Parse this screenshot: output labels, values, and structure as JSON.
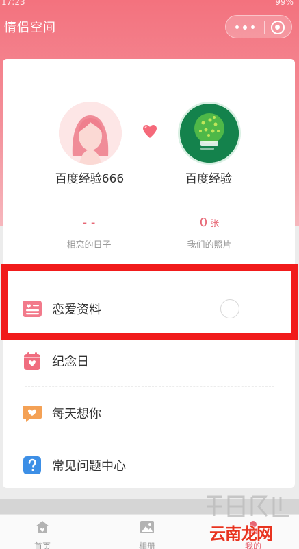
{
  "statusbar": {
    "time": "17:23",
    "battery": "99%"
  },
  "header": {
    "title": "情侣空间"
  },
  "couple": {
    "left_name": "百度经验666",
    "right_name": "百度经验"
  },
  "stats": {
    "days_value": "- -",
    "days_label": "相恋的日子",
    "photos_value": "0",
    "photos_unit": "张",
    "photos_label": "我们的照片"
  },
  "menu": [
    {
      "label": "恋爱资料",
      "icon": "profile-card-icon"
    },
    {
      "label": "纪念日",
      "icon": "calendar-heart-icon"
    },
    {
      "label": "每天想你",
      "icon": "heart-speech-icon"
    },
    {
      "label": "常见问题中心",
      "icon": "question-icon"
    }
  ],
  "tabs": [
    {
      "label": "首页",
      "icon": "home-icon"
    },
    {
      "label": "相册",
      "icon": "image-icon"
    },
    {
      "label": "我的",
      "icon": "user-icon"
    }
  ],
  "watermark": {
    "text": "云南龙网"
  },
  "colors": {
    "header": "#f3727e",
    "accent": "#e76674",
    "highlight": "#f11b1b"
  }
}
